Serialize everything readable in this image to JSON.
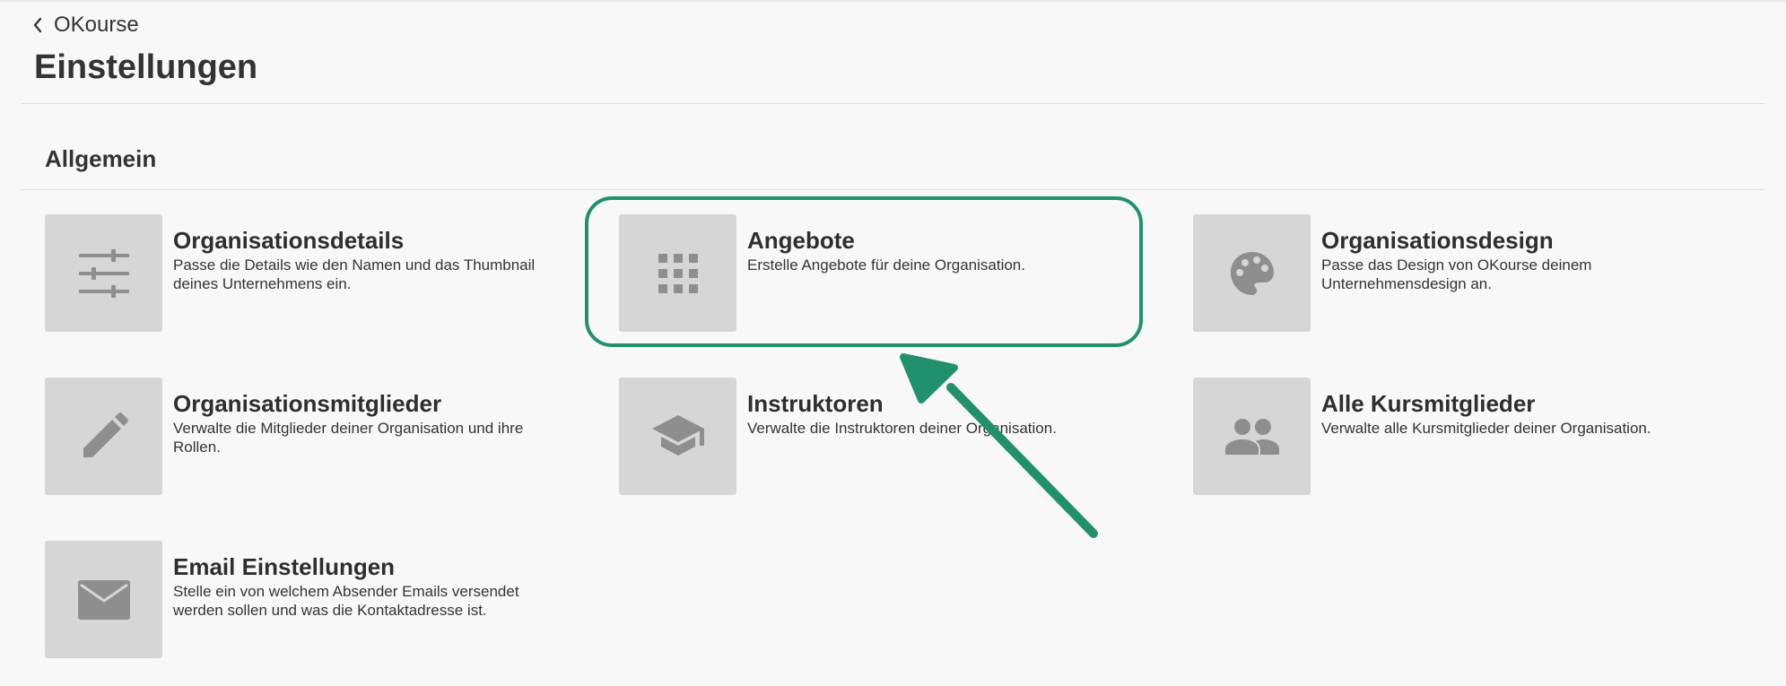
{
  "header": {
    "back_label": "OKourse",
    "title": "Einstellungen"
  },
  "section": {
    "title": "Allgemein"
  },
  "cards": [
    {
      "title": "Organisationsdetails",
      "description": "Passe die Details wie den Namen und das Thumbnail deines Unternehmens ein.",
      "icon": "sliders-icon"
    },
    {
      "title": "Angebote",
      "description": "Erstelle Angebote für deine Organisation.",
      "icon": "grid-icon"
    },
    {
      "title": "Organisationsdesign",
      "description": "Passe das Design von OKourse deinem Unternehmensdesign an.",
      "icon": "palette-icon"
    },
    {
      "title": "Organisationsmitglieder",
      "description": "Verwalte die Mitglieder deiner Organisation und ihre Rollen.",
      "icon": "pencil-icon"
    },
    {
      "title": "Instruktoren",
      "description": "Verwalte die Instruktoren deiner Organisation.",
      "icon": "graduation-cap-icon"
    },
    {
      "title": "Alle Kursmitglieder",
      "description": "Verwalte alle Kursmitglieder deiner Organisation.",
      "icon": "people-icon"
    },
    {
      "title": "Email Einstellungen",
      "description": "Stelle ein von welchem Absender Emails versendet werden sollen und was die Kontaktadresse ist.",
      "icon": "envelope-icon"
    }
  ],
  "annotation": {
    "color": "#21906c"
  },
  "colors": {
    "background": "#f8f8f8",
    "thumbnail": "#d6d6d6",
    "icon": "#8e8e8e"
  }
}
